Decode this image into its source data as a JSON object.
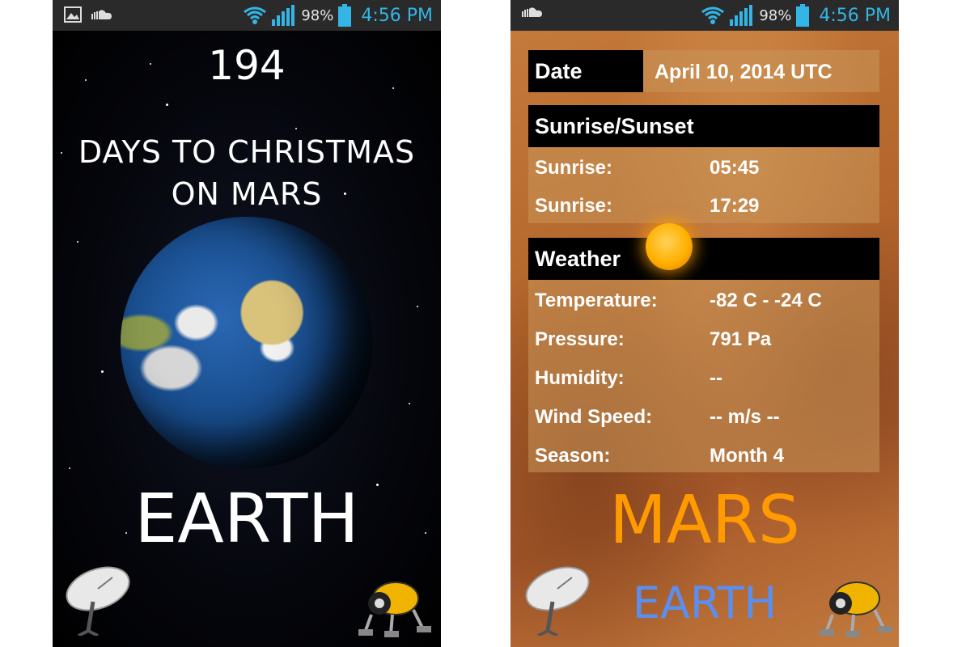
{
  "status_bar": {
    "battery": "98%",
    "time": "4:56 PM"
  },
  "earth_screen": {
    "countdown": "194",
    "days_line1": "DAYS TO CHRISTMAS",
    "days_line2": "ON MARS",
    "planet_label": "EARTH"
  },
  "mars_screen": {
    "date": {
      "label": "Date",
      "value": "April 10, 2014 UTC"
    },
    "sun": {
      "header": "Sunrise/Sunset",
      "rows": [
        {
          "label": "Sunrise:",
          "value": "05:45"
        },
        {
          "label": "Sunrise:",
          "value": "17:29"
        }
      ]
    },
    "weather": {
      "header": "Weather",
      "rows": [
        {
          "label": "Temperature:",
          "value": "-82 C - -24 C"
        },
        {
          "label": "Pressure:",
          "value": "791 Pa"
        },
        {
          "label": "Humidity:",
          "value": "--"
        },
        {
          "label": "Wind Speed:",
          "value": "-- m/s --"
        },
        {
          "label": "Season:",
          "value": "Month 4"
        }
      ]
    },
    "planet_label": "MARS",
    "switch_link": "EARTH"
  },
  "colors": {
    "status_time": "#33b5e5",
    "mars_title": "#ff9a00",
    "earth_link": "#5a8ff0"
  },
  "icons": [
    "gallery-icon",
    "soundcloud-icon",
    "wifi-icon",
    "signal-icon",
    "battery-icon",
    "satellite-dish-icon",
    "rover-icon",
    "sun-icon"
  ]
}
